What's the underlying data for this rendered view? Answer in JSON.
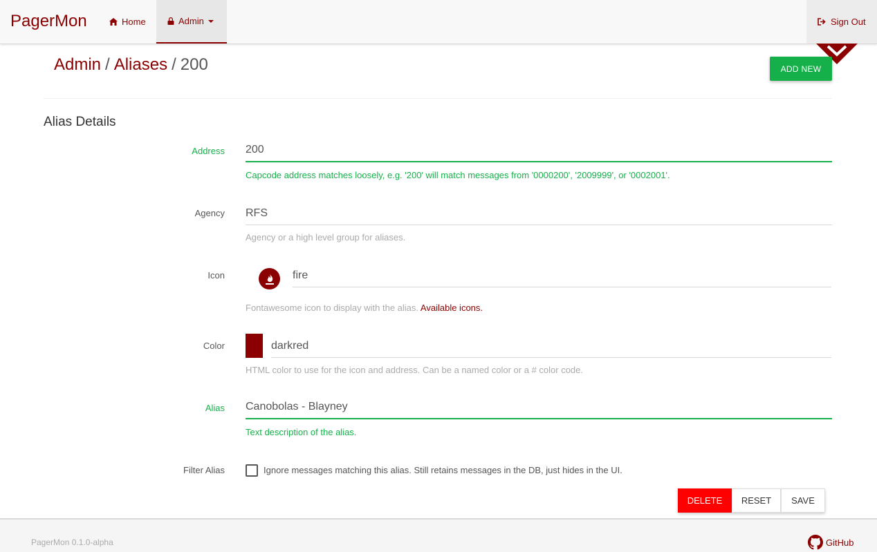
{
  "nav": {
    "brand": "PagerMon",
    "home": "Home",
    "admin": "Admin",
    "signout": "Sign Out"
  },
  "header": {
    "crumb_admin": "Admin",
    "sep": "/",
    "crumb_aliases": "Aliases",
    "crumb_current": "200",
    "add_new": "ADD NEW"
  },
  "section": {
    "title": "Alias Details"
  },
  "form": {
    "address": {
      "label": "Address",
      "value": "200",
      "help": "Capcode address matches loosely, e.g. '200' will match messages from '0000200', '2009999', or '0002001'."
    },
    "agency": {
      "label": "Agency",
      "value": "RFS",
      "help": "Agency or a high level group for aliases."
    },
    "icon": {
      "label": "Icon",
      "value": "fire",
      "help": "Fontawesome icon to display with the alias.",
      "help_link": "Available icons.",
      "icon_name": "fire-icon"
    },
    "color": {
      "label": "Color",
      "value": "darkred",
      "help": "HTML color to use for the icon and address. Can be a named color or a # color code.",
      "swatch": "#8b0000"
    },
    "alias": {
      "label": "Alias",
      "value": "Canobolas - Blayney",
      "help": "Text description of the alias."
    },
    "filter": {
      "label": "Filter Alias",
      "checkbox_label": "Ignore messages matching this alias. Still retains messages in the DB, just hides in the UI.",
      "checked": false
    }
  },
  "actions": {
    "delete": "DELETE",
    "reset": "RESET",
    "save": "SAVE"
  },
  "footer": {
    "version": "PagerMon 0.1.0-alpha",
    "github": "GitHub"
  },
  "colors": {
    "brand": "#8b0000",
    "success": "#16b04a",
    "danger": "#ff0000"
  }
}
